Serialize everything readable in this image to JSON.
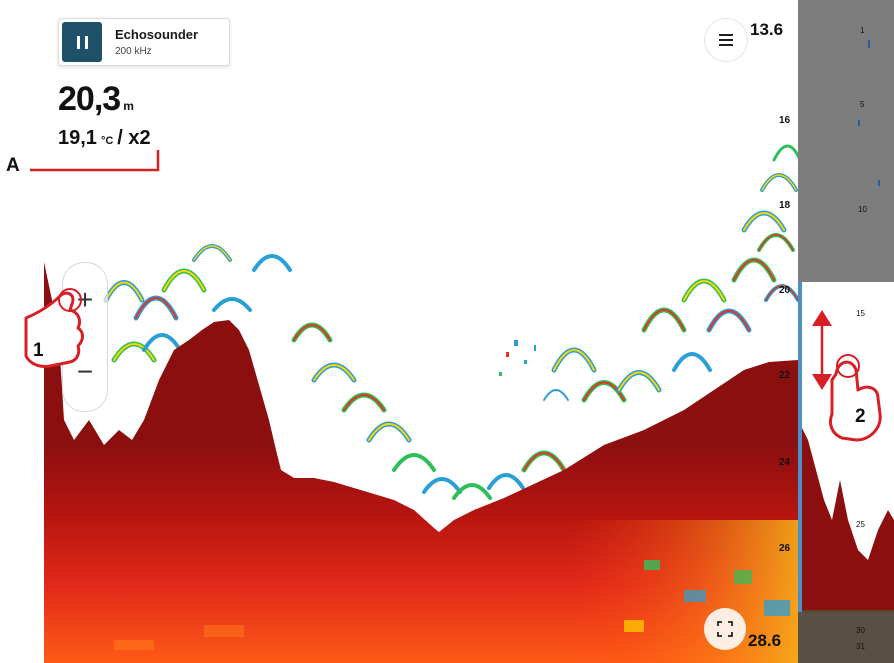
{
  "source": {
    "name": "Echosounder",
    "frequency": "200 kHz"
  },
  "readings": {
    "depth_value": "20,3",
    "depth_unit": "m",
    "temp_value": "19,1",
    "temp_unit": "°C",
    "zoom_factor": "x2"
  },
  "scale": {
    "top": "13.6",
    "bottom": "28.6",
    "ticks": [
      "16",
      "18",
      "20",
      "22",
      "24",
      "26"
    ],
    "overview_ticks": [
      "1",
      "5",
      "10",
      "15",
      "25",
      "30",
      "31"
    ]
  },
  "controls": {
    "zoom_in": "+",
    "zoom_out": "−"
  },
  "icons": {
    "pause": "pause-icon",
    "menu": "hamburger-menu-icon",
    "fullscreen": "fullscreen-icon",
    "hand": "pointing-hand-icon",
    "swipe": "vertical-swipe-arrow-icon"
  },
  "colors": {
    "pause_button": "#1e5068",
    "bottom_echo": "#8b0f0f",
    "callout": "#d61f26",
    "overview_shade": "#7d7d7d"
  },
  "callouts": {
    "a": "A",
    "one": "1",
    "two": "2"
  }
}
